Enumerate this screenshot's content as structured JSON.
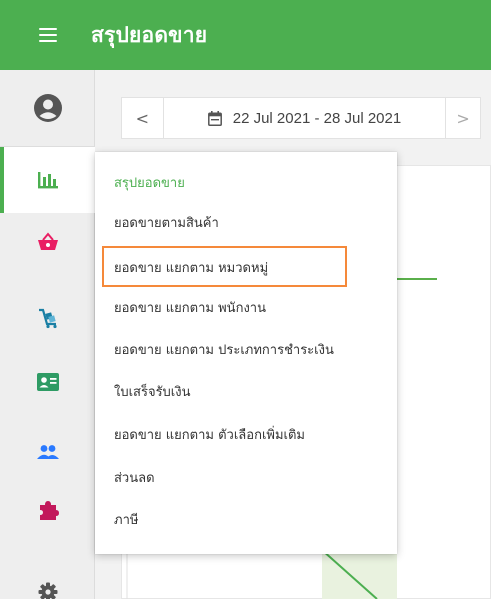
{
  "app": {
    "title": "สรุปยอดขาย"
  },
  "colors": {
    "brand": "#4caf50",
    "highlight": "#f5893a",
    "basket": "#e91e63",
    "cart": "#1a7fa4",
    "contact_card": "#2e9b64",
    "users": "#2979ff",
    "puzzle": "#c2185b",
    "gear": "#555555"
  },
  "sidebar": {
    "items": [
      {
        "icon": "account-circle-icon"
      },
      {
        "icon": "bar-chart-icon",
        "active": true
      },
      {
        "icon": "shopping-basket-icon"
      },
      {
        "icon": "cart-icon"
      },
      {
        "icon": "contact-card-icon"
      },
      {
        "icon": "users-icon"
      },
      {
        "icon": "puzzle-icon"
      },
      {
        "icon": "gear-icon"
      }
    ]
  },
  "date_range": {
    "prev": "<",
    "next": ">",
    "label": "22 Jul 2021 - 28 Jul 2021",
    "icon": "calendar-icon"
  },
  "menu": {
    "items": [
      {
        "label": "สรุปยอดขาย",
        "active": true
      },
      {
        "label": "ยอดขายตามสินค้า"
      },
      {
        "label": "ยอดขาย แยกตาม หมวดหมู่",
        "highlighted": true
      },
      {
        "label": "ยอดขาย แยกตาม พนักงาน"
      },
      {
        "label": "ยอดขาย แยกตาม ประเภทการชำระเงิน"
      },
      {
        "label": "ใบเสร็จรับเงิน"
      },
      {
        "label": "ยอดขาย แยกตาม ตัวเลือกเพิ่มเติม"
      },
      {
        "label": "ส่วนลด"
      },
      {
        "label": "ภาษี"
      }
    ]
  }
}
